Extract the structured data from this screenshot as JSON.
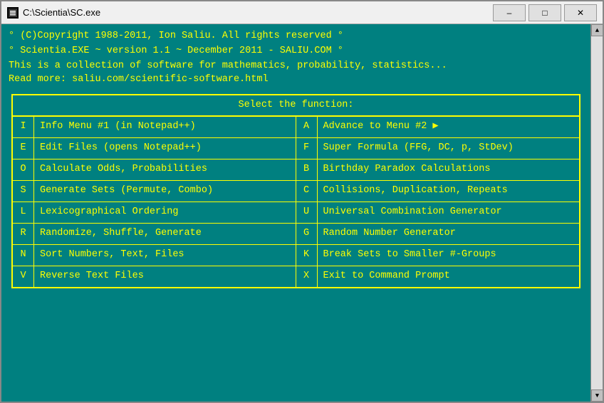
{
  "window": {
    "title": "C:\\Scientia\\SC.exe",
    "minimize_label": "–",
    "maximize_label": "□",
    "close_label": "✕"
  },
  "console": {
    "line1": "° (C)Copyright 1988-2011, Ion Saliu. All rights reserved °",
    "line2": "° Scientia.EXE ~ version 1.1 ~ December 2011 - SALIU.COM °",
    "line3": "This is a collection of software for mathematics, probability, statistics...",
    "line4": "Read more: saliu.com/scientific-software.html"
  },
  "menu": {
    "title": "Select the function:",
    "rows": [
      {
        "left_key": "I",
        "left_label": "Info Menu #1 (in Notepad++)",
        "right_key": "A",
        "right_label": "Advance to Menu #2 ▶"
      },
      {
        "left_key": "E",
        "left_label": "Edit Files (opens Notepad++)",
        "right_key": "F",
        "right_label": "Super Formula (FFG, DC, p, StDev)"
      },
      {
        "left_key": "O",
        "left_label": "Calculate Odds, Probabilities",
        "right_key": "B",
        "right_label": "Birthday Paradox Calculations"
      },
      {
        "left_key": "S",
        "left_label": "Generate Sets (Permute, Combo)",
        "right_key": "C",
        "right_label": "Collisions, Duplication, Repeats"
      },
      {
        "left_key": "L",
        "left_label": "Lexicographical Ordering",
        "right_key": "U",
        "right_label": "Universal Combination Generator"
      },
      {
        "left_key": "R",
        "left_label": "Randomize, Shuffle, Generate",
        "right_key": "G",
        "right_label": "Random Number Generator"
      },
      {
        "left_key": "N",
        "left_label": "Sort Numbers, Text, Files",
        "right_key": "K",
        "right_label": "Break Sets to Smaller #-Groups"
      },
      {
        "left_key": "V",
        "left_label": "Reverse Text Files",
        "right_key": "X",
        "right_label": "Exit to Command Prompt"
      }
    ]
  }
}
